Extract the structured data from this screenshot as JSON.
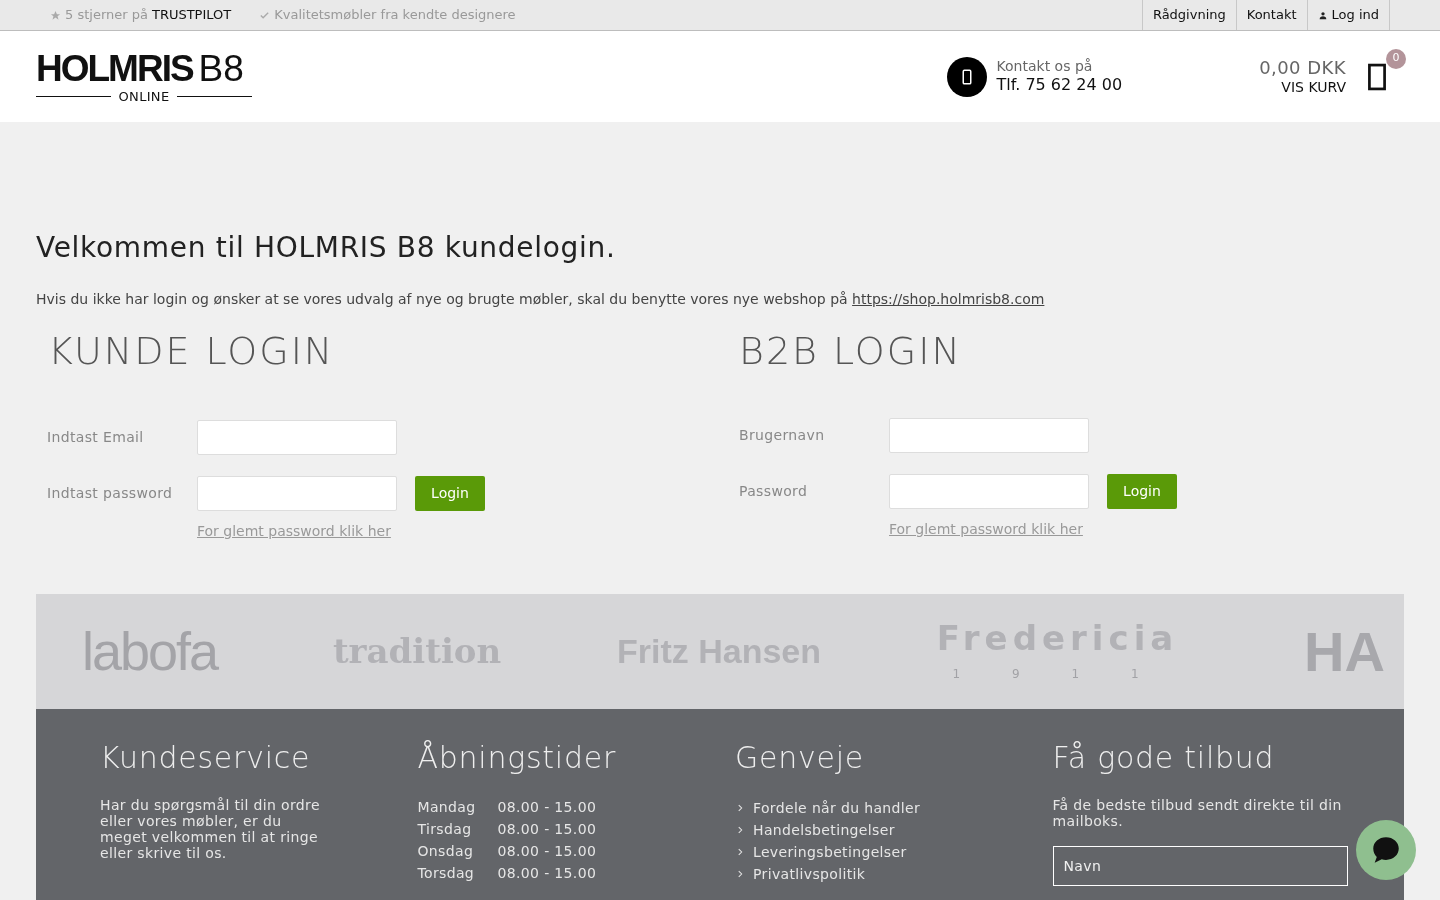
{
  "topbar": {
    "trust_prefix": "5 stjerner på",
    "trust_brand": "TRUSTPILOT",
    "tagline": "Kvalitetsmøbler fra kendte designere",
    "links": [
      {
        "label": "Rådgivning",
        "kind": "text"
      },
      {
        "label": "Kontakt",
        "kind": "text"
      },
      {
        "label": "Log ind",
        "kind": "user"
      }
    ]
  },
  "header": {
    "logo_main": "HOLMRIS",
    "logo_suffix": "B8",
    "logo_sub": "ONLINE",
    "contact_label": "Kontakt os på",
    "contact_phone": "Tlf. 75 62 24 00",
    "cart_total": "0,00 DKK",
    "cart_link": "VIS KURV",
    "cart_count": "0"
  },
  "main": {
    "heading": "Velkommen til HOLMRIS B8 kundelogin.",
    "intro": "Hvis du ikke har login og ønsker at se vores udvalg af nye og brugte møbler, skal du benytte vores nye webshop på",
    "intro_link": "https://shop.holmrisb8.com",
    "panels": [
      {
        "title": "KUNDE LOGIN",
        "fields": [
          {
            "label": "Indtast Email"
          },
          {
            "label": "Indtast password"
          }
        ],
        "button": "Login",
        "forgot": "For glemt password klik her"
      },
      {
        "title": "B2B LOGIN",
        "fields": [
          {
            "label": "Brugernavn"
          },
          {
            "label": "Password"
          }
        ],
        "button": "Login",
        "forgot": "For glemt password klik her"
      }
    ]
  },
  "brands": [
    {
      "name": "labofa",
      "kind": "thin"
    },
    {
      "name": "tradition",
      "kind": "serif"
    },
    {
      "name": "Fritz Hansen",
      "kind": "bold"
    },
    {
      "name": "Fredericia",
      "sub": "1 9 1 1",
      "kind": "spaced"
    },
    {
      "name": "HA",
      "kind": "faded"
    }
  ],
  "footer": {
    "columns": [
      {
        "title": "Kundeservice",
        "kind": "text",
        "text": "Har du spørgsmål til din ordre eller vores møbler, er du meget velkommen til at ringe eller skrive til os."
      },
      {
        "title": "Åbningstider",
        "kind": "hours",
        "rows": [
          {
            "day": "Mandag",
            "time": "08.00 - 15.00"
          },
          {
            "day": "Tirsdag",
            "time": "08.00 - 15.00"
          },
          {
            "day": "Onsdag",
            "time": "08.00 - 15.00"
          },
          {
            "day": "Torsdag",
            "time": "08.00 - 15.00"
          }
        ]
      },
      {
        "title": "Genveje",
        "kind": "links",
        "links": [
          "Fordele når du handler",
          "Handelsbetingelser",
          "Leveringsbetingelser",
          "Privatlivspolitik"
        ]
      },
      {
        "title": "Få gode tilbud",
        "kind": "newsletter",
        "text": "Få de bedste tilbud sendt direkte til din mailboks.",
        "placeholder": "Navn"
      }
    ]
  }
}
